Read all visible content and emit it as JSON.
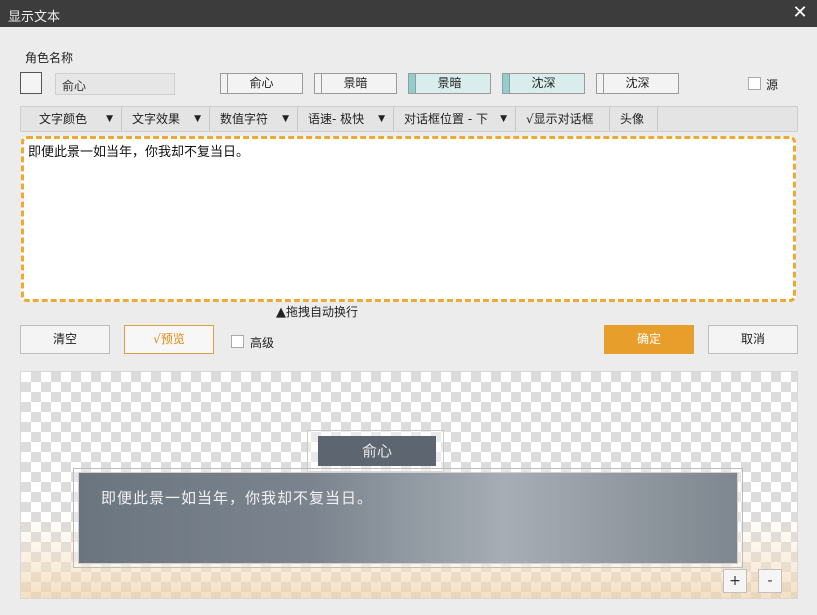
{
  "window": {
    "title": "显示文本",
    "close_icon": "close-icon"
  },
  "role": {
    "label": "角色名称",
    "name_value": "俞心",
    "source_label": "源"
  },
  "role_buttons": [
    {
      "label": "俞心",
      "selected": false
    },
    {
      "label": "景暗",
      "selected": false
    },
    {
      "label": "景暗",
      "selected": true
    },
    {
      "label": "沈深",
      "selected": true
    },
    {
      "label": "沈深",
      "selected": false
    }
  ],
  "toolbar": {
    "items": [
      {
        "label": "文字颜色",
        "has_dropdown": true
      },
      {
        "label": "文字效果",
        "has_dropdown": true
      },
      {
        "label": "数值字符",
        "has_dropdown": true
      },
      {
        "label": "语速- 极快",
        "has_dropdown": true
      },
      {
        "label": "对话框位置 - 下",
        "has_dropdown": true
      },
      {
        "label": "√显示对话框",
        "has_dropdown": false
      },
      {
        "label": "头像",
        "has_dropdown": false
      }
    ]
  },
  "editor": {
    "text": "即便此景一如当年，你我却不复当日。",
    "border_color": "#f0a830"
  },
  "drag_hint": "拖拽自动换行",
  "actions": {
    "clear_label": "清空",
    "preview_label": "√预览",
    "advanced_label": "高级",
    "confirm_label": "确定",
    "cancel_label": "取消"
  },
  "preview": {
    "name_tag": "俞心",
    "dialog_text": "即便此景一如当年，你我却不复当日。",
    "zoom_in": "+",
    "zoom_out": "-"
  },
  "colors": {
    "accent": "#e89e2a",
    "selected_role": "#8fd0cf",
    "titlebar": "#3c3c3c"
  }
}
